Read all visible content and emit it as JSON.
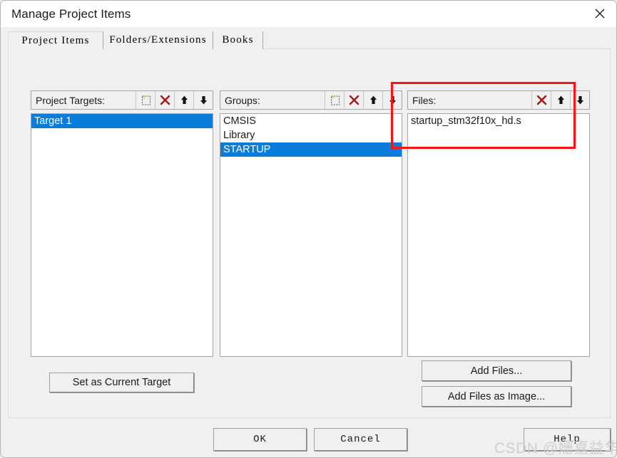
{
  "window": {
    "title": "Manage Project Items",
    "close_icon": "close-icon"
  },
  "tabs": [
    {
      "label": "Project Items",
      "active": true
    },
    {
      "label": "Folders/Extensions",
      "active": false
    },
    {
      "label": "Books",
      "active": false
    }
  ],
  "columns": {
    "targets": {
      "label": "Project Targets:",
      "toolbar": [
        "new-item-icon",
        "delete-icon",
        "move-up-icon",
        "move-down-icon"
      ],
      "items": [
        {
          "label": "Target 1",
          "selected": true
        }
      ]
    },
    "groups": {
      "label": "Groups:",
      "toolbar": [
        "new-item-icon",
        "delete-icon",
        "move-up-icon",
        "move-down-icon"
      ],
      "items": [
        {
          "label": "CMSIS",
          "selected": false
        },
        {
          "label": "Library",
          "selected": false
        },
        {
          "label": "STARTUP",
          "selected": true
        }
      ]
    },
    "files": {
      "label": "Files:",
      "toolbar": [
        "delete-icon",
        "move-up-icon",
        "move-down-icon"
      ],
      "items": [
        {
          "label": "startup_stm32f10x_hd.s",
          "selected": false
        }
      ]
    }
  },
  "buttons": {
    "set_as_current_target": "Set as Current Target",
    "add_files": "Add Files...",
    "add_files_as_image": "Add Files as Image...",
    "ok": "OK",
    "cancel": "Cancel",
    "help": "Help"
  },
  "annotation": {
    "color": "#f21717",
    "target": "files-column"
  },
  "watermark": {
    "text": "CSDN @姗嘉益华"
  },
  "colors": {
    "selection": "#0a7ddb",
    "dialog_bg": "#f0f0f0",
    "listbox_bg": "#ffffff",
    "delete_icon": "#a01818"
  }
}
